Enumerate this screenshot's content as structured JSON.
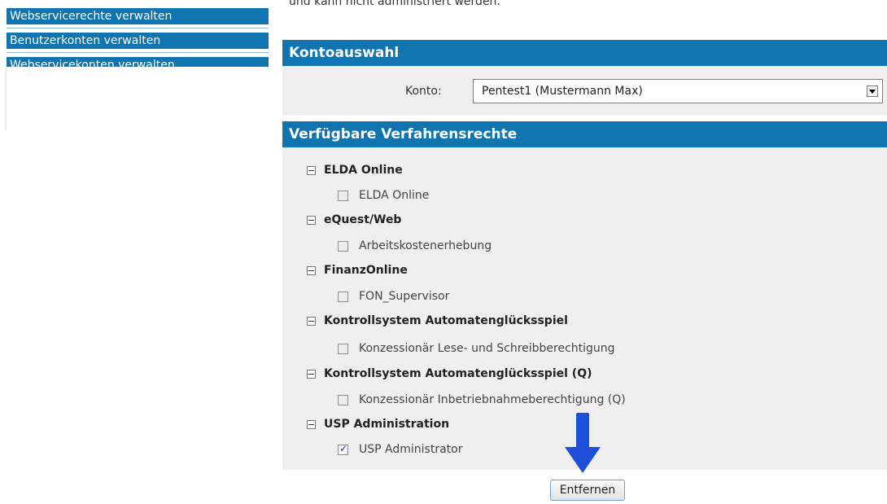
{
  "sidebar": {
    "items": [
      {
        "label": "Webservicerechte verwalten"
      },
      {
        "label": "Benutzerkonten verwalten"
      },
      {
        "label": "Webservicekonten verwalten"
      }
    ]
  },
  "main": {
    "intro_text": "und kann nicht administriert werden.",
    "account_section": {
      "title": "Kontoauswahl",
      "label": "Konto:",
      "selected": "Pentest1 (Mustermann Max)"
    },
    "rights_section": {
      "title": "Verfügbare Verfahrensrechte",
      "groups": [
        {
          "label": "ELDA Online",
          "items": [
            {
              "label": "ELDA Online",
              "checked": false
            }
          ]
        },
        {
          "label": "eQuest/Web",
          "items": [
            {
              "label": "Arbeitskostenerhebung",
              "checked": false
            }
          ]
        },
        {
          "label": "FinanzOnline",
          "items": [
            {
              "label": "FON_Supervisor",
              "checked": false
            }
          ]
        },
        {
          "label": "Kontrollsystem Automatenglücksspiel",
          "items": [
            {
              "label": "Konzessionär Lese- und Schreibberechtigung",
              "checked": false
            }
          ]
        },
        {
          "label": "Kontrollsystem Automatenglücksspiel (Q)",
          "items": [
            {
              "label": "Konzessionär Inbetriebnahmeberechtigung (Q)",
              "checked": false
            }
          ]
        },
        {
          "label": "USP Administration",
          "items": [
            {
              "label": "USP Administrator",
              "checked": true
            }
          ]
        }
      ]
    },
    "remove_button": "Entfernen"
  },
  "colors": {
    "accent": "#0f74b0",
    "panel_bg": "#efefef",
    "annotation_arrow": "#1e4fd8"
  },
  "icons": {
    "collapse": "collapse-minus-icon",
    "dropdown": "chevron-down-icon",
    "annotation": "arrow-down-icon"
  }
}
